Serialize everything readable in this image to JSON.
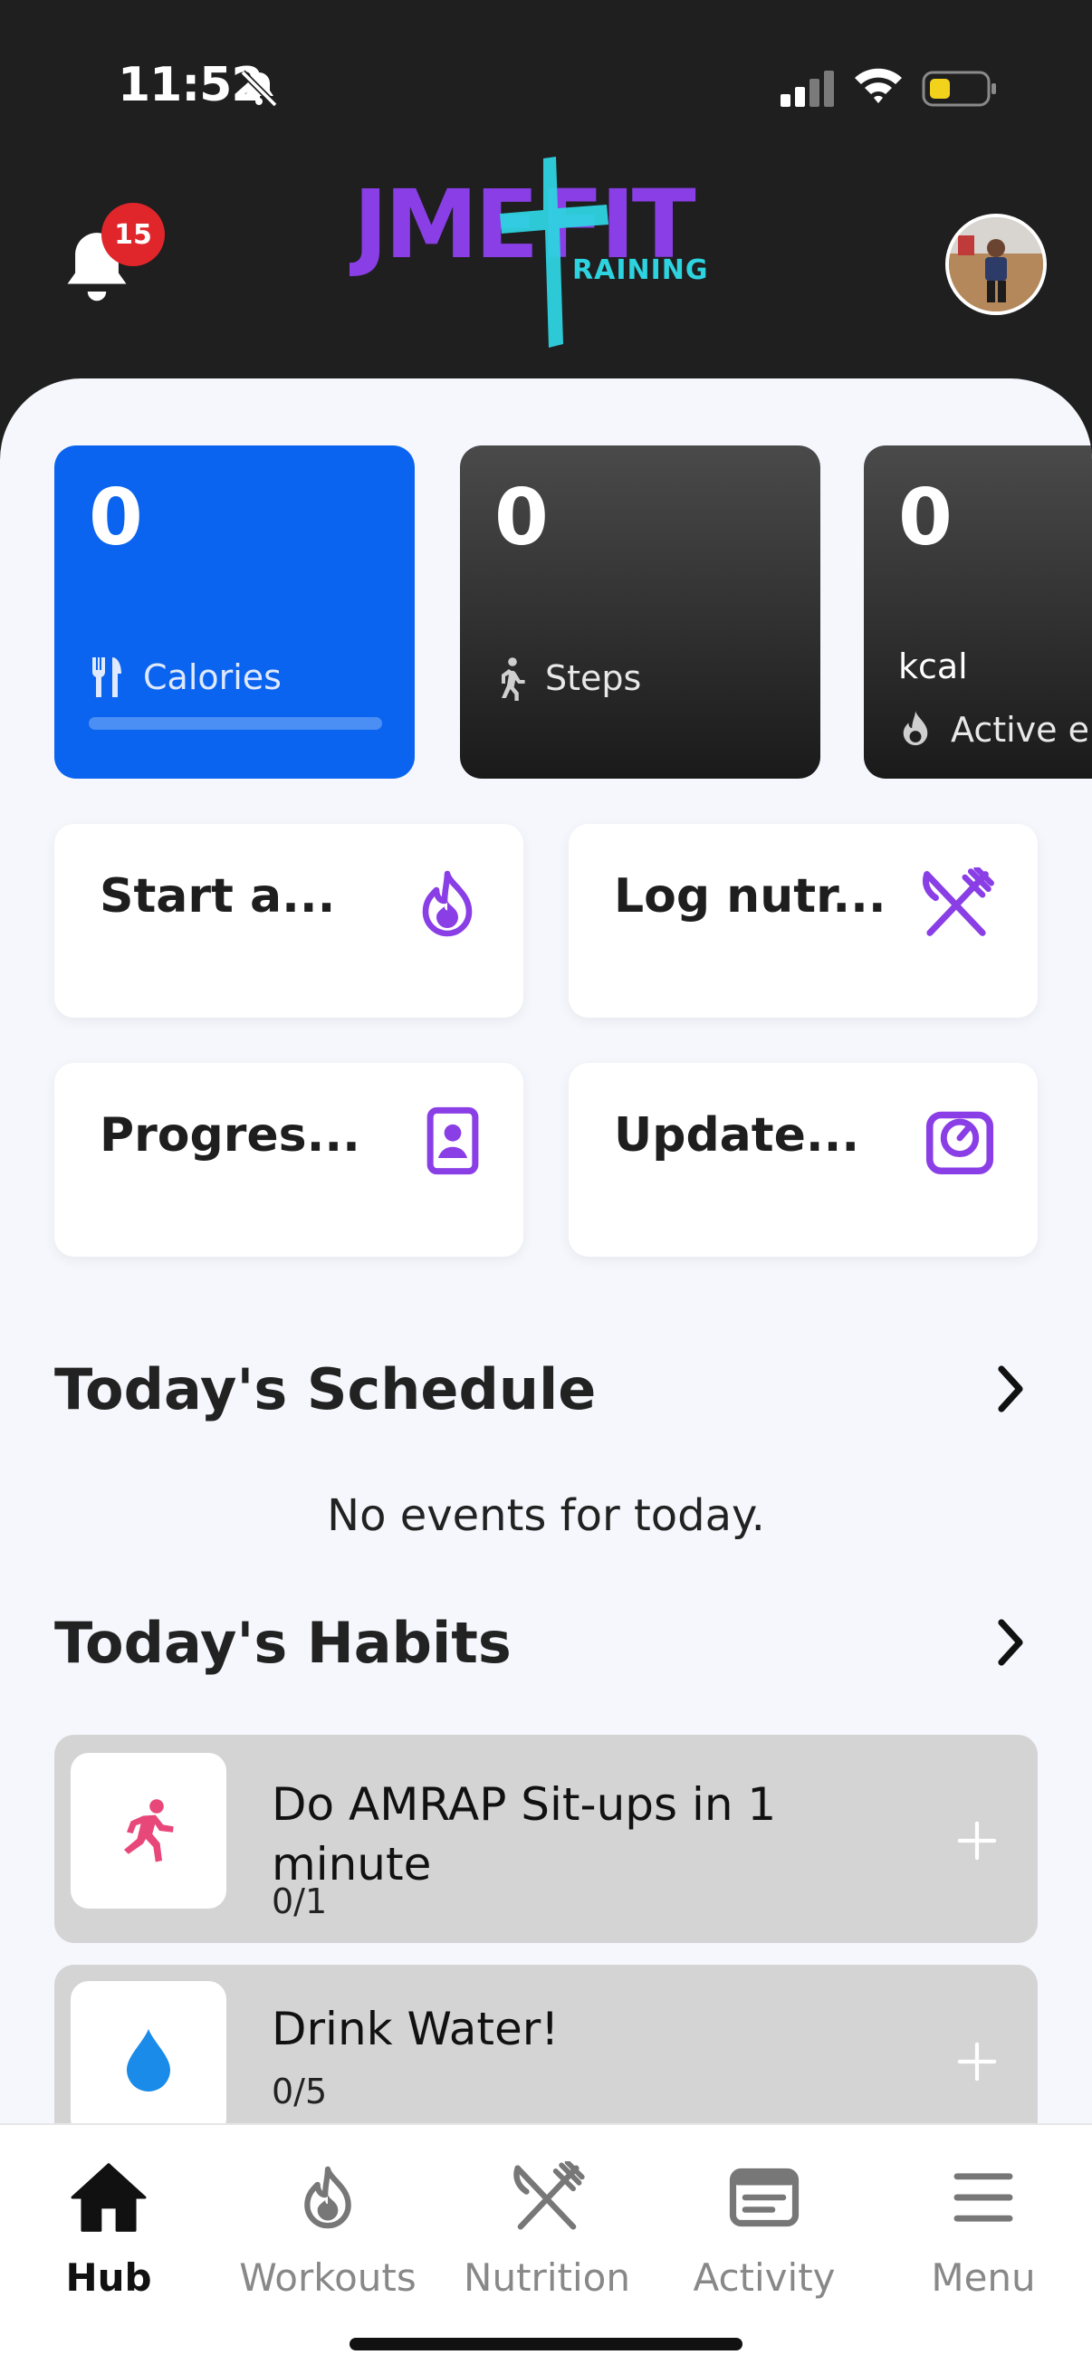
{
  "status_bar": {
    "time": "11:52"
  },
  "header": {
    "notifications_count": "15"
  },
  "stats": [
    {
      "value": "0",
      "label": "Calories"
    },
    {
      "value": "0",
      "label": "Steps"
    },
    {
      "value": "0",
      "unit": "kcal",
      "label": "Active e"
    }
  ],
  "actions": [
    {
      "label": "Start a...",
      "icon": "flame-icon"
    },
    {
      "label": "Log nutr...",
      "icon": "fork-knife-icon"
    },
    {
      "label": "Progres...",
      "icon": "profile-card-icon"
    },
    {
      "label": "Update...",
      "icon": "scale-icon"
    }
  ],
  "schedule": {
    "title": "Today's Schedule",
    "empty_text": "No events for today."
  },
  "habits": {
    "title": "Today's Habits",
    "items": [
      {
        "title": "Do AMRAP Sit-ups in 1 minute",
        "count": "0/1",
        "icon": "running-icon",
        "color": "#e8477a"
      },
      {
        "title": "Drink Water!",
        "count": "0/5",
        "icon": "water-drop-icon",
        "color": "#1a8be8"
      }
    ]
  },
  "nav": [
    {
      "label": "Hub",
      "active": true
    },
    {
      "label": "Workouts"
    },
    {
      "label": "Nutrition"
    },
    {
      "label": "Activity"
    },
    {
      "label": "Menu"
    }
  ],
  "colors": {
    "accent_blue": "#0a64ef",
    "brand_purple": "#8a3ee6",
    "brand_cyan": "#2ed3e0",
    "badge_red": "#e0262b"
  }
}
